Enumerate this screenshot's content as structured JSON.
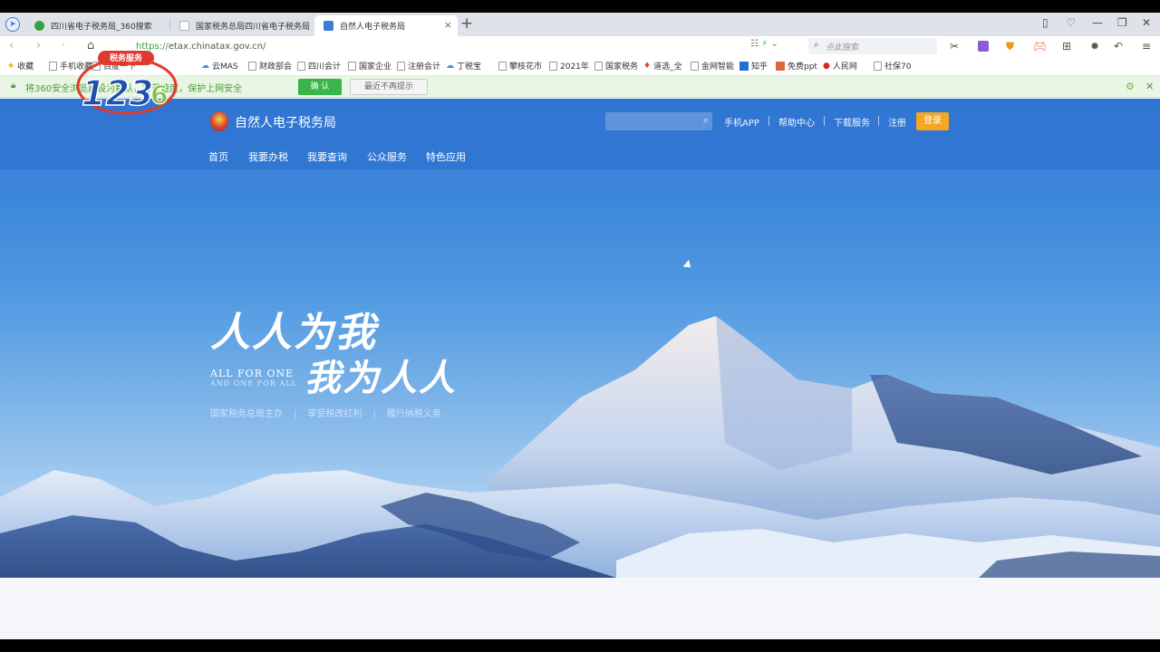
{
  "browser": {
    "tabs": [
      {
        "label": "四川省电子税务局_360搜索",
        "favicon_color": "#3aa142"
      },
      {
        "label": "国家税务总局四川省电子税务局",
        "favicon_color": "#cfd5de"
      },
      {
        "label": "自然人电子税务局",
        "favicon_color": "#3a7bd5",
        "close": "×"
      }
    ],
    "new_tab": "+",
    "url_scheme": "https://",
    "url_host": "etax.chinatax.gov.cn/",
    "search_placeholder": "点此搜索",
    "bookmarks": [
      "收藏",
      "手机收藏",
      "百度一下",
      "",
      "云MAS",
      "财政部会",
      "四川会计",
      "国家企业",
      "注册会计",
      "丁税宝",
      "攀枝花市",
      "2021年",
      "国家税务",
      "道选_全",
      "金网智能",
      "知乎",
      "免费ppt",
      "人民网",
      "社保70"
    ],
    "notice_text": "将360安全浏览器设为默认，打开速度，保护上网安全",
    "notice_confirm": "确 认",
    "notice_ignore": "最近不再提示"
  },
  "site": {
    "title": "自然人电子税务局",
    "top_links": [
      "手机APP",
      "帮助中心",
      "下载服务",
      "注册"
    ],
    "login_label": "登录",
    "nav": [
      "首页",
      "我要办税",
      "我要查询",
      "公众服务",
      "特色应用"
    ],
    "hero": {
      "slogan_line1": "人人为我",
      "slogan_line2": "我为人人",
      "english_line1": "ALL FOR ONE",
      "english_line2": "AND ONE FOR ALL",
      "sub_items": [
        "国家税务总局主办",
        "享受税改红利",
        "履行纳税义务"
      ],
      "sub_separator": "|"
    }
  },
  "watermark": {
    "top_text": "税务服务",
    "digits": "123",
    "tail": "6"
  },
  "colors": {
    "site_blue": "#3a7fd6",
    "login_orange": "#f5a623",
    "notice_green": "#3bb54a"
  }
}
